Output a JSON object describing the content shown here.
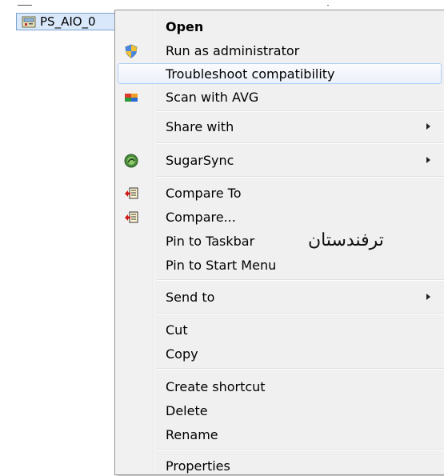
{
  "file": {
    "name": "PS_AIO_0",
    "icon": "installer-file-icon"
  },
  "menu": {
    "items": [
      {
        "label": "Open",
        "bold": true
      },
      {
        "label": "Run as administrator",
        "icon": "uac-shield-icon"
      },
      {
        "label": "Troubleshoot compatibility",
        "highlighted": true
      },
      {
        "label": "Scan with AVG",
        "icon": "avg-icon"
      },
      {
        "label": "Share with",
        "submenu": true
      },
      {
        "label": "SugarSync",
        "icon": "sugarsync-icon",
        "submenu": true
      },
      {
        "label": "Compare To",
        "icon": "compare-icon"
      },
      {
        "label": "Compare...",
        "icon": "compare-icon"
      },
      {
        "label": "Pin to Taskbar"
      },
      {
        "label": "Pin to Start Menu"
      },
      {
        "label": "Send to",
        "submenu": true
      },
      {
        "label": "Cut"
      },
      {
        "label": "Copy"
      },
      {
        "label": "Create shortcut"
      },
      {
        "label": "Delete"
      },
      {
        "label": "Rename"
      },
      {
        "label": "Properties"
      }
    ]
  },
  "watermark": "ترفندستان",
  "colors": {
    "highlight_border": "#aecff7",
    "menu_bg": "#f0f0f0",
    "selection_bg": "#d9e8fb"
  }
}
